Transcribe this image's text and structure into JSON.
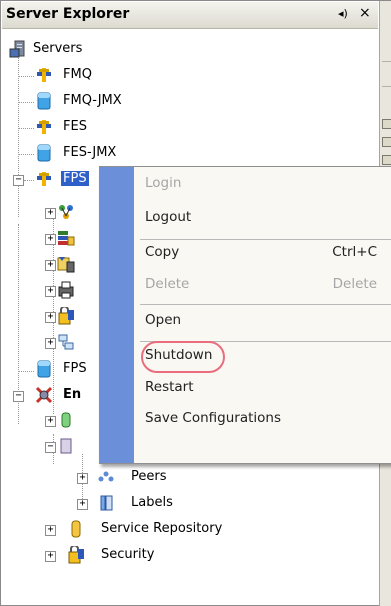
{
  "panel": {
    "title": "Server Explorer",
    "pin_glyph": "◂)",
    "close_glyph": "×"
  },
  "tree": {
    "root_label": "Servers",
    "servers": [
      "FMQ",
      "FMQ-JMX",
      "FES",
      "FES-JMX",
      "FPS",
      "FPS"
    ],
    "enterprise_label": "En",
    "peers_label": "Peers",
    "labels_label": "Labels",
    "service_repository_label": "Service Repository",
    "security_label": "Security"
  },
  "context_menu": {
    "items": [
      {
        "label": "Login",
        "shortcut": "",
        "enabled": false
      },
      {
        "label": "Logout",
        "shortcut": "",
        "enabled": true
      },
      {
        "label": "Copy",
        "shortcut": "Ctrl+C",
        "enabled": true
      },
      {
        "label": "Delete",
        "shortcut": "Delete",
        "enabled": false
      },
      {
        "label": "Open",
        "shortcut": "",
        "enabled": true
      },
      {
        "label": "Shutdown",
        "shortcut": "",
        "enabled": true,
        "highlighted": true
      },
      {
        "label": "Restart",
        "shortcut": "",
        "enabled": true
      },
      {
        "label": "Save Configurations",
        "shortcut": "",
        "enabled": true
      }
    ]
  },
  "colors": {
    "selection": "#2f5fc9",
    "menu_gutter": "#6b8fd8",
    "highlight_ring": "#ea6d7d"
  }
}
